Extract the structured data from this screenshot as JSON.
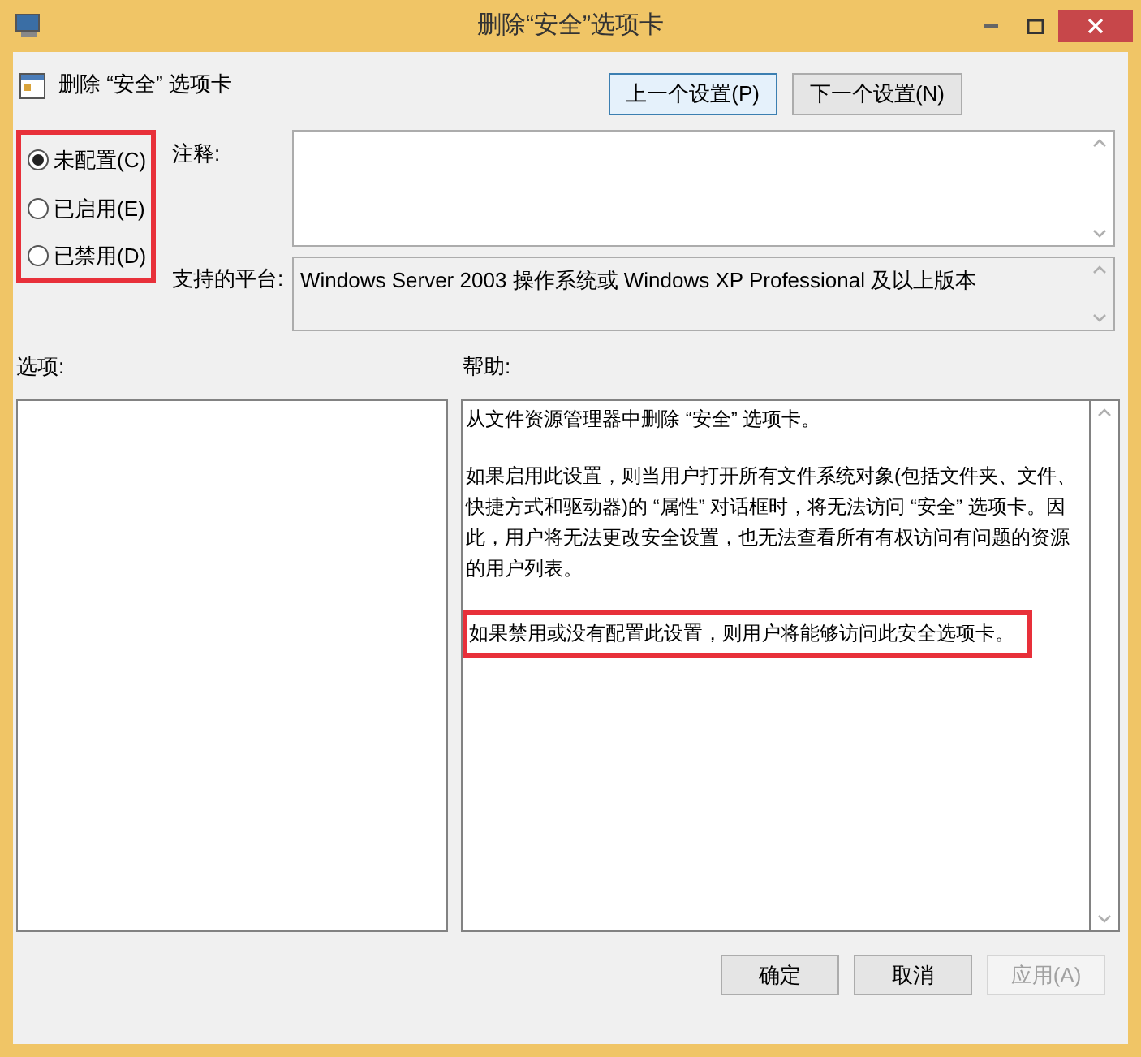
{
  "window": {
    "title": "删除“安全”选项卡"
  },
  "header": {
    "title": "删除 “安全” 选项卡"
  },
  "nav_buttons": [
    {
      "label": "上一个设置(P)",
      "focused": true
    },
    {
      "label": "下一个设置(N)",
      "focused": false
    }
  ],
  "options": [
    {
      "label": "未配置(C)",
      "selected": true
    },
    {
      "label": "已启用(E)",
      "selected": false
    },
    {
      "label": "已禁用(D)",
      "selected": false
    }
  ],
  "comment": {
    "label": "注释:"
  },
  "platform": {
    "label": "支持的平台:",
    "value": "Windows Server 2003 操作系统或 Windows XP Professional 及以上版本"
  },
  "options_pane": {
    "label": "选项:"
  },
  "help_pane": {
    "label": "帮助:",
    "paragraphs": [
      {
        "text": "从文件资源管理器中删除 “安全” 选项卡。",
        "highlighted": false
      },
      {
        "text": "如果启用此设置，则当用户打开所有文件系统对象(包括文件夹、文件、快捷方式和驱动器)的 “属性” 对话框时，将无法访问 “安全” 选项卡。因此，用户将无法更改安全设置，也无法查看所有有权访问有问题的资源的用户列表。",
        "highlighted": false
      },
      {
        "text": "如果禁用或没有配置此设置，则用户将能够访问此安全选项卡。",
        "highlighted": true
      }
    ]
  },
  "buttons": [
    {
      "label": "确定",
      "disabled": false
    },
    {
      "label": "取消",
      "disabled": false
    },
    {
      "label": "应用(A)",
      "disabled": true
    }
  ]
}
